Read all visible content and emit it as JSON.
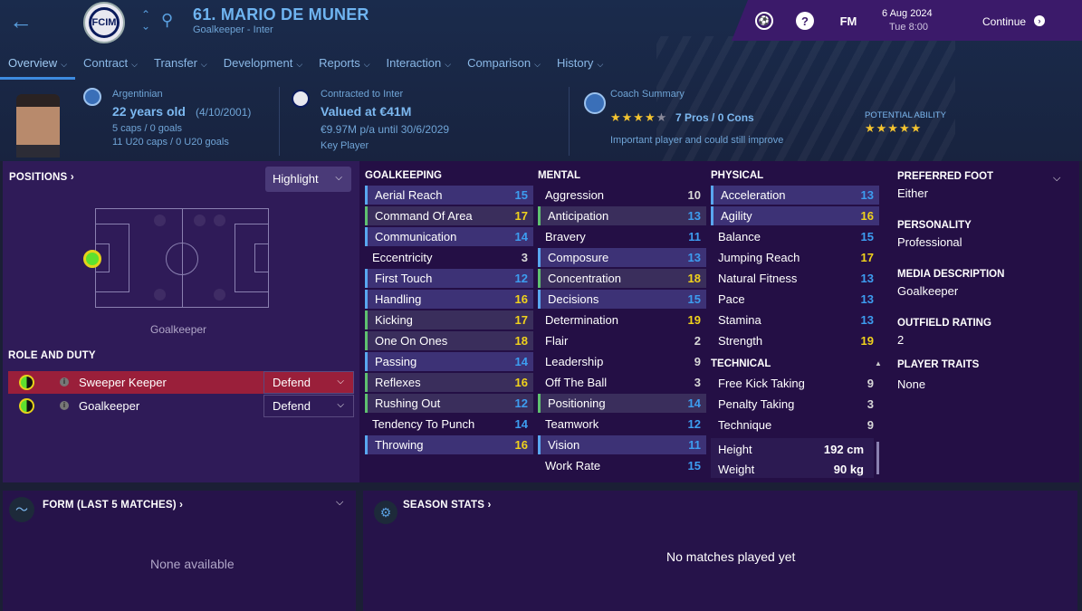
{
  "header": {
    "player_name": "61. MARIO DE MUNER",
    "subtitle": "Goalkeeper - Inter",
    "club_badge_text": "FCIM",
    "date": "6 Aug 2024",
    "time": "Tue 8:00",
    "fm_label": "FM",
    "help_label": "?",
    "continue_label": "Continue"
  },
  "tabs": [
    {
      "label": "Overview",
      "active": true
    },
    {
      "label": "Contract"
    },
    {
      "label": "Transfer"
    },
    {
      "label": "Development"
    },
    {
      "label": "Reports"
    },
    {
      "label": "Interaction"
    },
    {
      "label": "Comparison"
    },
    {
      "label": "History"
    }
  ],
  "info": {
    "nationality": "Argentinian",
    "age": "22 years old",
    "dob": "(4/10/2001)",
    "caps": "5 caps / 0 goals",
    "u20_caps": "11 U20 caps / 0 U20 goals",
    "contract_label": "Contracted to Inter",
    "value": "Valued at €41M",
    "wage": "€9.97M p/a until 30/6/2029",
    "squad_status": "Key Player",
    "coach_summary_label": "Coach Summary",
    "coach_stars": 4,
    "coach_max_stars": 5,
    "pros_cons": "7 Pros / 0 Cons",
    "coach_note": "Important player and could still improve",
    "potential_label": "POTENTIAL ABILITY",
    "potential_stars": 5
  },
  "positions": {
    "title": "POSITIONS ›",
    "highlight_label": "Highlight",
    "position_label": "Goalkeeper"
  },
  "roles": {
    "title": "ROLE AND DUTY",
    "items": [
      {
        "name": "Sweeper Keeper",
        "duty": "Defend",
        "selected": true
      },
      {
        "name": "Goalkeeper",
        "duty": "Defend",
        "selected": false
      }
    ]
  },
  "attributes": {
    "goalkeeping": {
      "title": "GOALKEEPING",
      "items": [
        {
          "name": "Aerial Reach",
          "value": "15",
          "color": "blue",
          "style": "hl"
        },
        {
          "name": "Command Of Area",
          "value": "17",
          "color": "yellow",
          "style": "mk"
        },
        {
          "name": "Communication",
          "value": "14",
          "color": "blue",
          "style": "hl"
        },
        {
          "name": "Eccentricity",
          "value": "3",
          "color": "grey",
          "style": ""
        },
        {
          "name": "First Touch",
          "value": "12",
          "color": "blue",
          "style": "hl"
        },
        {
          "name": "Handling",
          "value": "16",
          "color": "yellow",
          "style": "hl"
        },
        {
          "name": "Kicking",
          "value": "17",
          "color": "yellow",
          "style": "mk"
        },
        {
          "name": "One On Ones",
          "value": "18",
          "color": "yellow",
          "style": "mk"
        },
        {
          "name": "Passing",
          "value": "14",
          "color": "blue",
          "style": "hl"
        },
        {
          "name": "Reflexes",
          "value": "16",
          "color": "yellow",
          "style": "mk"
        },
        {
          "name": "Rushing Out",
          "value": "12",
          "color": "blue",
          "style": "mk"
        },
        {
          "name": "Tendency To Punch",
          "value": "14",
          "color": "blue",
          "style": ""
        },
        {
          "name": "Throwing",
          "value": "16",
          "color": "yellow",
          "style": "hl"
        }
      ]
    },
    "mental": {
      "title": "MENTAL",
      "items": [
        {
          "name": "Aggression",
          "value": "10",
          "color": "grey",
          "style": ""
        },
        {
          "name": "Anticipation",
          "value": "13",
          "color": "blue",
          "style": "mk"
        },
        {
          "name": "Bravery",
          "value": "11",
          "color": "blue",
          "style": ""
        },
        {
          "name": "Composure",
          "value": "13",
          "color": "blue",
          "style": "hl"
        },
        {
          "name": "Concentration",
          "value": "18",
          "color": "yellow",
          "style": "mk"
        },
        {
          "name": "Decisions",
          "value": "15",
          "color": "blue",
          "style": "hl"
        },
        {
          "name": "Determination",
          "value": "19",
          "color": "yellow",
          "style": ""
        },
        {
          "name": "Flair",
          "value": "2",
          "color": "grey",
          "style": ""
        },
        {
          "name": "Leadership",
          "value": "9",
          "color": "grey",
          "style": ""
        },
        {
          "name": "Off The Ball",
          "value": "3",
          "color": "grey",
          "style": ""
        },
        {
          "name": "Positioning",
          "value": "14",
          "color": "blue",
          "style": "mk"
        },
        {
          "name": "Teamwork",
          "value": "12",
          "color": "blue",
          "style": ""
        },
        {
          "name": "Vision",
          "value": "11",
          "color": "blue",
          "style": "hl"
        },
        {
          "name": "Work Rate",
          "value": "15",
          "color": "blue",
          "style": ""
        }
      ]
    },
    "physical": {
      "title": "PHYSICAL",
      "items": [
        {
          "name": "Acceleration",
          "value": "13",
          "color": "blue",
          "style": "hl"
        },
        {
          "name": "Agility",
          "value": "16",
          "color": "yellow",
          "style": "hl"
        },
        {
          "name": "Balance",
          "value": "15",
          "color": "blue",
          "style": ""
        },
        {
          "name": "Jumping Reach",
          "value": "17",
          "color": "yellow",
          "style": ""
        },
        {
          "name": "Natural Fitness",
          "value": "13",
          "color": "blue",
          "style": ""
        },
        {
          "name": "Pace",
          "value": "13",
          "color": "blue",
          "style": ""
        },
        {
          "name": "Stamina",
          "value": "13",
          "color": "blue",
          "style": ""
        },
        {
          "name": "Strength",
          "value": "19",
          "color": "yellow",
          "style": ""
        }
      ]
    },
    "technical": {
      "title": "TECHNICAL",
      "items": [
        {
          "name": "Free Kick Taking",
          "value": "9",
          "color": "grey",
          "style": ""
        },
        {
          "name": "Penalty Taking",
          "value": "3",
          "color": "grey",
          "style": ""
        },
        {
          "name": "Technique",
          "value": "9",
          "color": "grey",
          "style": ""
        }
      ]
    },
    "height_label": "Height",
    "height": "192 cm",
    "weight_label": "Weight",
    "weight": "90 kg"
  },
  "side": {
    "preferred_foot_label": "PREFERRED FOOT",
    "preferred_foot": "Either",
    "personality_label": "PERSONALITY",
    "personality": "Professional",
    "media_label": "MEDIA DESCRIPTION",
    "media": "Goalkeeper",
    "outfield_label": "OUTFIELD RATING",
    "outfield": "2",
    "traits_label": "PLAYER TRAITS",
    "traits": "None"
  },
  "form": {
    "title": "FORM (LAST 5 MATCHES) ›",
    "empty": "None available"
  },
  "season": {
    "title": "SEASON STATS ›",
    "empty": "No matches played yet"
  },
  "colors": {
    "blue": "#3d9df0",
    "yellow": "#f0d21c",
    "grey": "#d8d8d8",
    "accent": "#6fb4f0",
    "topbar": "#3b1a6a"
  }
}
